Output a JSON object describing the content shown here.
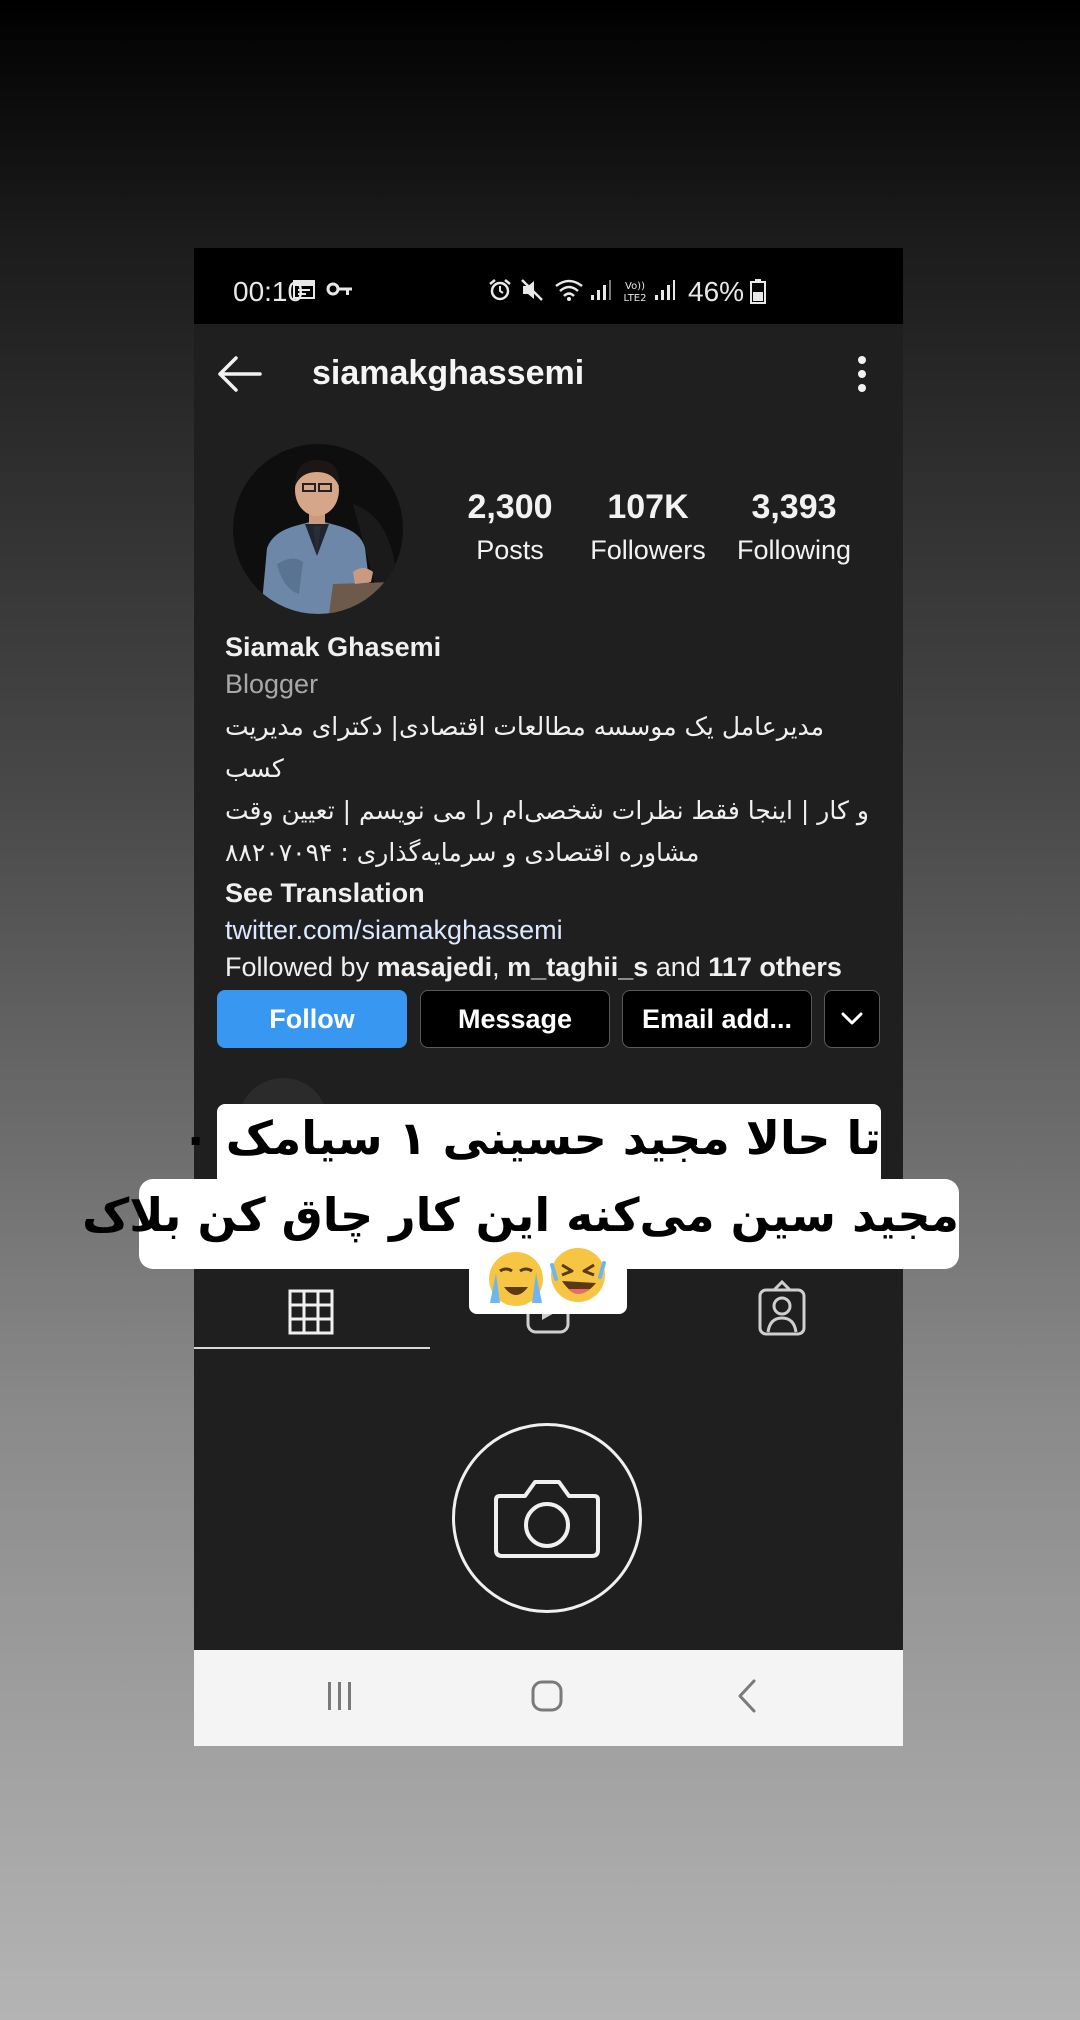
{
  "status_bar": {
    "time": "00:10",
    "battery": "46%",
    "icons": [
      "calendar-icon",
      "key-icon",
      "alarm-icon",
      "mute-icon",
      "wifi-icon",
      "signal-icon",
      "volte-lte2-icon",
      "signal-icon",
      "battery-icon"
    ]
  },
  "app_bar": {
    "username": "siamakghassemi",
    "back_icon": "arrow-left-icon",
    "more_icon": "more-vertical-icon"
  },
  "profile": {
    "posts_count": "2,300",
    "posts_label": "Posts",
    "followers_count": "107K",
    "followers_label": "Followers",
    "following_count": "3,393",
    "following_label": "Following",
    "name": "Siamak Ghasemi",
    "category": "Blogger",
    "bio_line1": "مدیرعامل یک موسسه مطالعات اقتصادی| دکترای مدیریت کسب",
    "bio_line2": "و کار | اینجا فقط نظرات شخصی‌ام را می نویسم | تعیین وقت",
    "bio_line3": "مشاوره اقتصادی و سرمایه‌گذاری : ۸۸۲۰۷۰۹۴",
    "see_translation": "See Translation",
    "link": "twitter.com/siamakghassemi",
    "followed_by_prefix": "Followed by ",
    "followed_by_user1": "masajedi",
    "followed_by_sep": ", ",
    "followed_by_user2": "m_taghii_s",
    "followed_by_and": " and ",
    "followed_by_others": "117 others"
  },
  "actions": {
    "follow": "Follow",
    "message": "Message",
    "email": "Email add...",
    "dropdown_icon": "chevron-down-icon"
  },
  "tabs": [
    "grid-icon",
    "reels-icon",
    "tagged-icon"
  ],
  "empty_state_icon": "camera-icon",
  "nav_bar": [
    "recent-apps-icon",
    "home-icon",
    "back-icon"
  ],
  "sticker": {
    "line1": "تا حالا مجید حسینی ۱ سیامک ۰",
    "line2": "مجید سین می‌کنه این کار چاق کن بلاک",
    "emojis": [
      "laughing-emoji",
      "crying-emoji"
    ]
  },
  "colors": {
    "follow_button": "#3897f0",
    "app_background": "#1f1f1f",
    "status_bar": "#000000",
    "nav_bar": "#f4f4f4"
  }
}
